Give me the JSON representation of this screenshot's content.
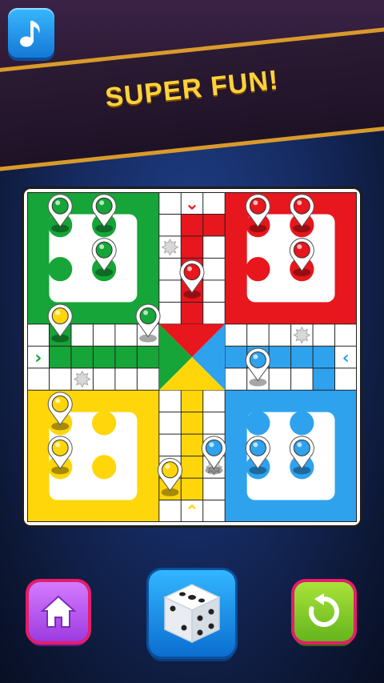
{
  "banner": {
    "text": "SUPER FUN!"
  },
  "colors": {
    "green": "#16a538",
    "red": "#e8161d",
    "yellow": "#ffd60a",
    "blue": "#2fa2ee",
    "banner_border": "#d99a2b",
    "banner_text": "#ffd23a"
  },
  "top_bar": {
    "music_button": {
      "icon": "music-note-icon"
    }
  },
  "bottom_bar": {
    "home_button": {
      "icon": "home-icon"
    },
    "dice_button": {
      "icon": "dice-icon"
    },
    "restart_button": {
      "icon": "restart-icon"
    }
  },
  "board": {
    "grid": "15x15",
    "yards": [
      {
        "color": "green",
        "position": "top-left"
      },
      {
        "color": "red",
        "position": "top-right"
      },
      {
        "color": "yellow",
        "position": "bottom-left"
      },
      {
        "color": "blue",
        "position": "bottom-right"
      }
    ],
    "track_cells": {
      "green": [
        [
          7,
          1
        ],
        [
          7,
          2
        ],
        [
          7,
          3
        ],
        [
          7,
          4
        ],
        [
          7,
          5
        ],
        [
          6,
          1
        ]
      ],
      "red": [
        [
          1,
          7
        ],
        [
          2,
          7
        ],
        [
          3,
          7
        ],
        [
          4,
          7
        ],
        [
          5,
          7
        ],
        [
          1,
          8
        ]
      ],
      "blue": [
        [
          7,
          9
        ],
        [
          7,
          10
        ],
        [
          7,
          11
        ],
        [
          7,
          12
        ],
        [
          7,
          13
        ],
        [
          8,
          13
        ]
      ],
      "yellow": [
        [
          9,
          7
        ],
        [
          10,
          7
        ],
        [
          11,
          7
        ],
        [
          12,
          7
        ],
        [
          13,
          7
        ],
        [
          13,
          6
        ]
      ]
    },
    "safe_stars": [
      [
        2,
        6
      ],
      [
        8,
        2
      ],
      [
        6,
        12
      ],
      [
        12,
        8
      ]
    ],
    "arrows": [
      {
        "at": [
          0,
          7
        ],
        "symbol": "⌄",
        "color": "red"
      },
      {
        "at": [
          7,
          0
        ],
        "symbol": "›",
        "color": "green"
      },
      {
        "at": [
          7,
          14
        ],
        "symbol": "‹",
        "color": "blue"
      },
      {
        "at": [
          14,
          7
        ],
        "symbol": "⌃",
        "color": "yellow"
      }
    ],
    "yard_spots": [
      {
        "color": "green",
        "row": 1.5,
        "col": 1.5
      },
      {
        "color": "green",
        "row": 1.5,
        "col": 3.5
      },
      {
        "color": "green",
        "row": 3.5,
        "col": 1.5
      },
      {
        "color": "green",
        "row": 3.5,
        "col": 3.5
      },
      {
        "color": "red",
        "row": 1.5,
        "col": 10.5
      },
      {
        "color": "red",
        "row": 1.5,
        "col": 12.5
      },
      {
        "color": "red",
        "row": 3.5,
        "col": 10.5
      },
      {
        "color": "red",
        "row": 3.5,
        "col": 12.5
      },
      {
        "color": "yellow",
        "row": 10.5,
        "col": 1.5
      },
      {
        "color": "yellow",
        "row": 10.5,
        "col": 3.5
      },
      {
        "color": "yellow",
        "row": 12.5,
        "col": 1.5
      },
      {
        "color": "yellow",
        "row": 12.5,
        "col": 3.5
      },
      {
        "color": "blue",
        "row": 10.5,
        "col": 10.5
      },
      {
        "color": "blue",
        "row": 10.5,
        "col": 12.5
      },
      {
        "color": "blue",
        "row": 12.5,
        "col": 10.5
      },
      {
        "color": "blue",
        "row": 12.5,
        "col": 12.5
      }
    ],
    "pieces": [
      {
        "color": "green",
        "row": 1.5,
        "col": 1.5
      },
      {
        "color": "green",
        "row": 1.5,
        "col": 3.5
      },
      {
        "color": "green",
        "row": 3.5,
        "col": 3.5
      },
      {
        "color": "green",
        "row": 6.5,
        "col": 5.5
      },
      {
        "color": "red",
        "row": 1.5,
        "col": 10.5
      },
      {
        "color": "red",
        "row": 1.5,
        "col": 12.5
      },
      {
        "color": "red",
        "row": 3.5,
        "col": 12.5
      },
      {
        "color": "red",
        "row": 4.5,
        "col": 7.5
      },
      {
        "color": "yellow",
        "row": 6.5,
        "col": 1.5
      },
      {
        "color": "yellow",
        "row": 10.5,
        "col": 1.5
      },
      {
        "color": "yellow",
        "row": 12.5,
        "col": 1.5
      },
      {
        "color": "yellow",
        "row": 13.5,
        "col": 6.5
      },
      {
        "color": "blue",
        "row": 8.5,
        "col": 10.5
      },
      {
        "color": "blue",
        "row": 12.5,
        "col": 10.5
      },
      {
        "color": "blue",
        "row": 12.5,
        "col": 12.5
      },
      {
        "color": "blue",
        "row": 12.5,
        "col": 8.5
      }
    ]
  }
}
